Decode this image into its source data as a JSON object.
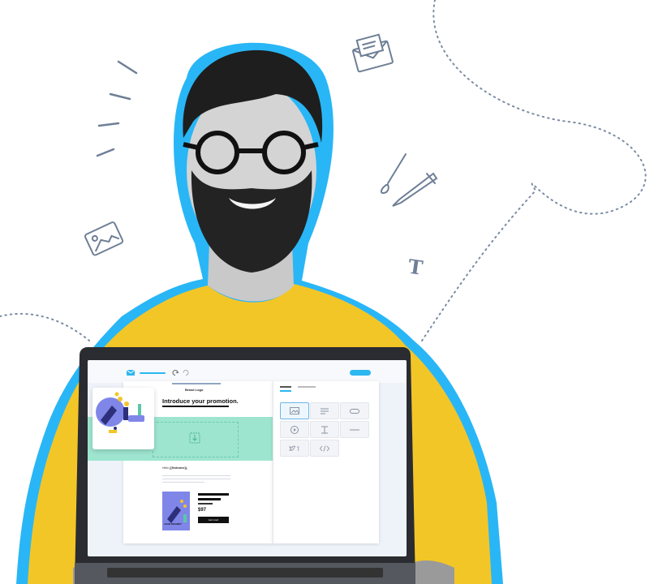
{
  "email": {
    "brand_logo": "Brand Logo",
    "headline": "Introduce your promotion.",
    "greeting_prefix": "Hello",
    "greeting_tag": "{{firstname}},",
    "product_title": "LEAD MAGNET",
    "price": "$97",
    "cta_label": "Get it now!"
  },
  "toolbar": {
    "undo_icon": "undo-icon",
    "redo_icon": "redo-icon"
  },
  "side_panel": {
    "tools": [
      "image-tool-icon",
      "text-tool-icon",
      "button-tool-icon",
      "video-tool-icon",
      "spacer-tool-icon",
      "divider-tool-icon",
      "social-tool-icon",
      "html-tool-icon"
    ]
  },
  "colors": {
    "accent": "#2bb7f0",
    "sweater": "#f2c422",
    "highlight": "#9ee5d0"
  }
}
